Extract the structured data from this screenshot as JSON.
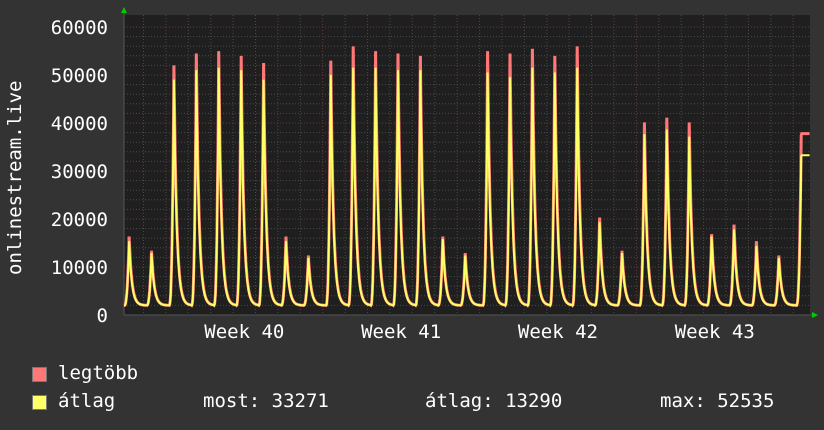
{
  "chart_data": {
    "type": "line",
    "title": "",
    "ylabel": "onlinestream.live",
    "xlabel": "",
    "ylim": [
      0,
      60000
    ],
    "yticks": [
      "0",
      "10000",
      "20000",
      "30000",
      "40000",
      "50000",
      "60000"
    ],
    "ytick_values": [
      0,
      10000,
      20000,
      30000,
      40000,
      50000,
      60000
    ],
    "xunit": "days",
    "xlim": [
      0.13,
      30.75
    ],
    "week_boundaries": [
      2,
      9,
      16,
      23
    ],
    "xticks": [
      {
        "label": "Week 40",
        "x": 5.5
      },
      {
        "label": "Week 41",
        "x": 12.5
      },
      {
        "label": "Week 42",
        "x": 19.5
      },
      {
        "label": "Week 43",
        "x": 26.5
      }
    ],
    "grid": true,
    "night_minimum": 2000,
    "series": [
      {
        "name": "legtöbb",
        "color": "#ff7878",
        "daily_peaks": [
          16500,
          13500,
          52500,
          55000,
          55500,
          54500,
          53000,
          16500,
          12500,
          53500,
          56500,
          55500,
          55000,
          54500,
          16500,
          13000,
          55500,
          55000,
          56000,
          54500,
          56500,
          20500,
          13500,
          40500,
          41500,
          40500,
          17000,
          19000,
          15500,
          12500,
          37800
        ]
      },
      {
        "name": "átlag",
        "color": "#ffff66",
        "daily_peaks": [
          15500,
          13000,
          49500,
          51500,
          52000,
          51500,
          49500,
          15500,
          12000,
          50500,
          52000,
          52000,
          51500,
          51500,
          16000,
          12500,
          51000,
          50000,
          52000,
          51000,
          52000,
          19500,
          13000,
          38000,
          39000,
          37500,
          16500,
          18000,
          14500,
          12000,
          33271
        ]
      }
    ]
  },
  "legend": {
    "items": [
      {
        "label": "legtöbb",
        "color": "#ff7878"
      },
      {
        "label": "átlag",
        "color": "#ffff66"
      }
    ],
    "stats": {
      "most": "most: 33271",
      "atlag": "átlag: 13290",
      "max": "max: 52535"
    }
  }
}
